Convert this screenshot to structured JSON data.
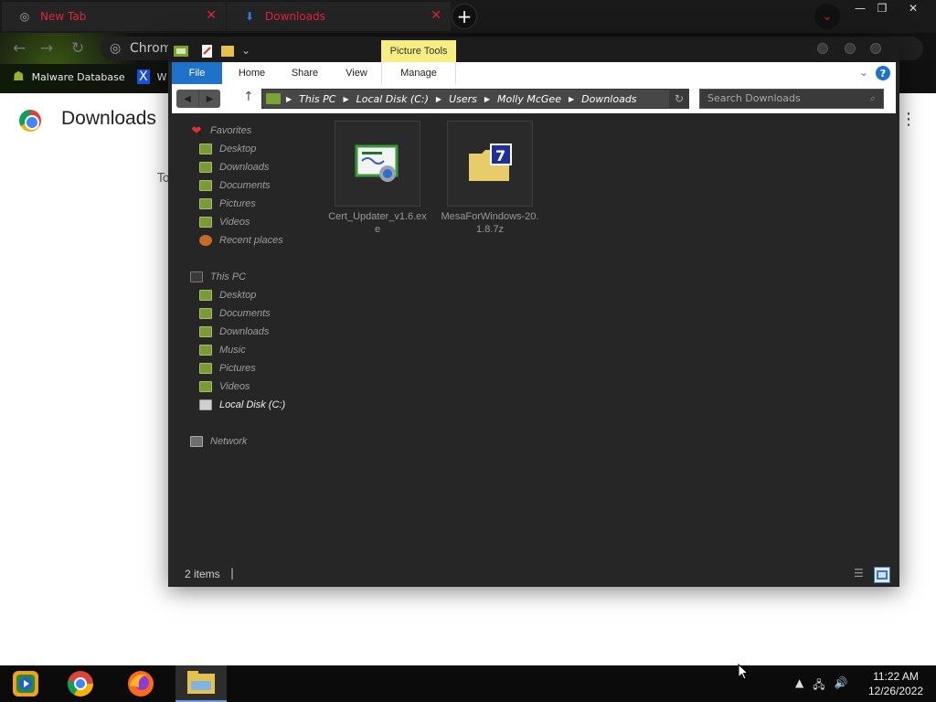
{
  "chrome": {
    "tabs": [
      {
        "label": "New Tab",
        "icon": "chrome-icon"
      },
      {
        "label": "Downloads",
        "icon": "download-icon"
      }
    ],
    "new_tab_glyph": "+",
    "window_controls": {
      "minimize": "—",
      "restore": "❐",
      "close": "✕"
    },
    "omnibox_text": "Chrom",
    "bookmarks": [
      {
        "label": "Malware Database",
        "icon": "skull-icon"
      },
      {
        "label": "W",
        "icon": "x-icon"
      }
    ],
    "page": {
      "title": "Downloads",
      "section_label": "To",
      "menu_glyph": "⋮"
    }
  },
  "explorer": {
    "contextual_tab": "Picture Tools",
    "ribbon_tabs": [
      "File",
      "Home",
      "Share",
      "View",
      "Manage"
    ],
    "help_glyph": "?",
    "breadcrumb": [
      "This PC",
      "Local Disk (C:)",
      "Users",
      "Molly McGee",
      "Downloads"
    ],
    "search_placeholder": "Search Downloads",
    "nav": {
      "favorites_header": "Favorites",
      "favorites": [
        "Desktop",
        "Downloads",
        "Documents",
        "Pictures",
        "Videos",
        "Recent places"
      ],
      "thispc_header": "This PC",
      "thispc": [
        "Desktop",
        "Documents",
        "Downloads",
        "Music",
        "Pictures",
        "Videos",
        "Local Disk (C:)"
      ],
      "network": "Network"
    },
    "files": [
      {
        "name": "Cert_Updater_v1.6.exe",
        "icon": "certificate-exe-icon"
      },
      {
        "name": "MesaForWindows-20.1.8.7z",
        "icon": "7zip-archive-icon"
      }
    ],
    "status": "2 items"
  },
  "taskbar": {
    "apps": [
      "windows-media-icon",
      "chrome-icon",
      "firefox-icon",
      "file-explorer-icon"
    ],
    "time": "11:22 AM",
    "date": "12/26/2022"
  }
}
